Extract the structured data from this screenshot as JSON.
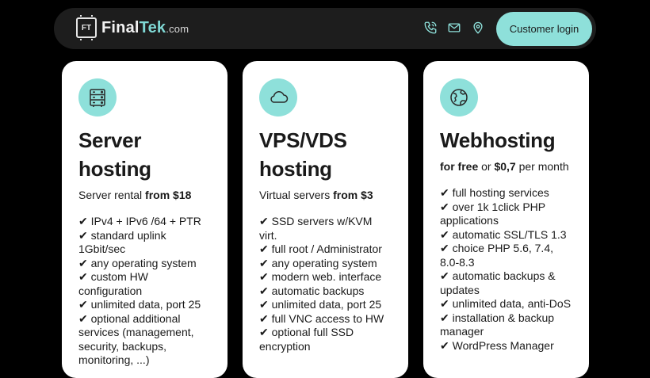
{
  "nav": {
    "logo_badge": "FT",
    "logo_part1": "Final",
    "logo_part2": "Tek",
    "logo_domain": ".com",
    "icons": [
      "phone-icon",
      "mail-icon",
      "location-pin-icon"
    ],
    "login_label": "Customer login"
  },
  "colors": {
    "background": "#000000",
    "nav_bg": "#1d1d1d",
    "accent": "#8ee0da",
    "card_bg": "#ffffff"
  },
  "cards": [
    {
      "icon": "server-icon",
      "title": "Server hosting",
      "sub_prefix": "Server rental ",
      "sub_bold": "from $18",
      "features": [
        "IPv4 + IPv6 /64 + PTR",
        "standard uplink 1Gbit/sec",
        "any operating system",
        "custom HW configuration",
        "unlimited data, port 25",
        "optional additional services (management, security, backups, monitoring, ...)"
      ]
    },
    {
      "icon": "cloud-icon",
      "title": "VPS/VDS hosting",
      "sub_prefix": "Virtual servers ",
      "sub_bold": "from $3",
      "features": [
        "SSD servers w/KVM virt.",
        "full root / Administrator",
        "any operating system",
        "modern web. interface",
        "automatic backups",
        "unlimited data, port 25",
        "full VNC access to HW",
        "optional full SSD encryption"
      ]
    },
    {
      "icon": "globe-icon",
      "title": "Webhosting",
      "sub_bold1": "for free",
      "sub_mid": " or ",
      "sub_bold2": "$0,7",
      "sub_suffix": " per month",
      "features": [
        "full hosting services",
        "over 1k 1click PHP applications",
        "automatic SSL/TLS 1.3",
        "choice PHP 5.6, 7.4, 8.0-8.3",
        "automatic backups & updates",
        "unlimited data, anti-DoS",
        "installation & backup manager",
        "WordPress Manager"
      ]
    }
  ]
}
